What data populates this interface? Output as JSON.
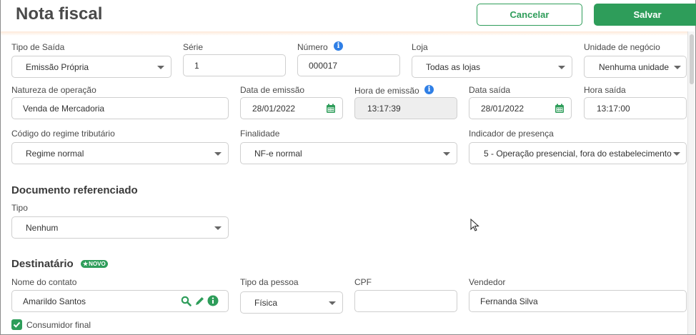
{
  "header": {
    "title": "Nota fiscal",
    "cancel_label": "Cancelar",
    "save_label": "Salvar"
  },
  "row1": {
    "tipo_saida": {
      "label": "Tipo de Saída",
      "value": "Emissão Própria"
    },
    "serie": {
      "label": "Série",
      "value": "1"
    },
    "numero": {
      "label": "Número",
      "value": "000017"
    },
    "loja": {
      "label": "Loja",
      "value": "Todas as lojas"
    },
    "unidade": {
      "label": "Unidade de negócio",
      "value": "Nenhuma unidade"
    }
  },
  "row2": {
    "natureza": {
      "label": "Natureza de operação",
      "value": "Venda de Mercadoria"
    },
    "data_emissao": {
      "label": "Data de emissão",
      "value": "28/01/2022"
    },
    "hora_emissao": {
      "label": "Hora de emissão",
      "value": "13:17:39"
    },
    "data_saida": {
      "label": "Data saída",
      "value": "28/01/2022"
    },
    "hora_saida": {
      "label": "Hora saída",
      "value": "13:17:00"
    }
  },
  "row3": {
    "regime": {
      "label": "Código do regime tributário",
      "value": "Regime normal"
    },
    "finalidade": {
      "label": "Finalidade",
      "value": "NF-e normal"
    },
    "indicador": {
      "label": "Indicador de presença",
      "value": "5 - Operação presencial, fora do estabelecimento"
    }
  },
  "documento": {
    "title": "Documento referenciado",
    "tipo": {
      "label": "Tipo",
      "value": "Nenhum"
    }
  },
  "destinatario": {
    "title": "Destinatário",
    "badge": "NOVO",
    "nome": {
      "label": "Nome do contato",
      "value": "Amarildo Santos"
    },
    "tipo_pessoa": {
      "label": "Tipo da pessoa",
      "value": "Física"
    },
    "cpf": {
      "label": "CPF",
      "value": ""
    },
    "vendedor": {
      "label": "Vendedor",
      "value": "Fernanda Silva"
    },
    "consumidor_final": {
      "label": "Consumidor final",
      "checked": true
    }
  },
  "colors": {
    "accent": "#2e9d5a",
    "info": "#2f7fe6"
  }
}
